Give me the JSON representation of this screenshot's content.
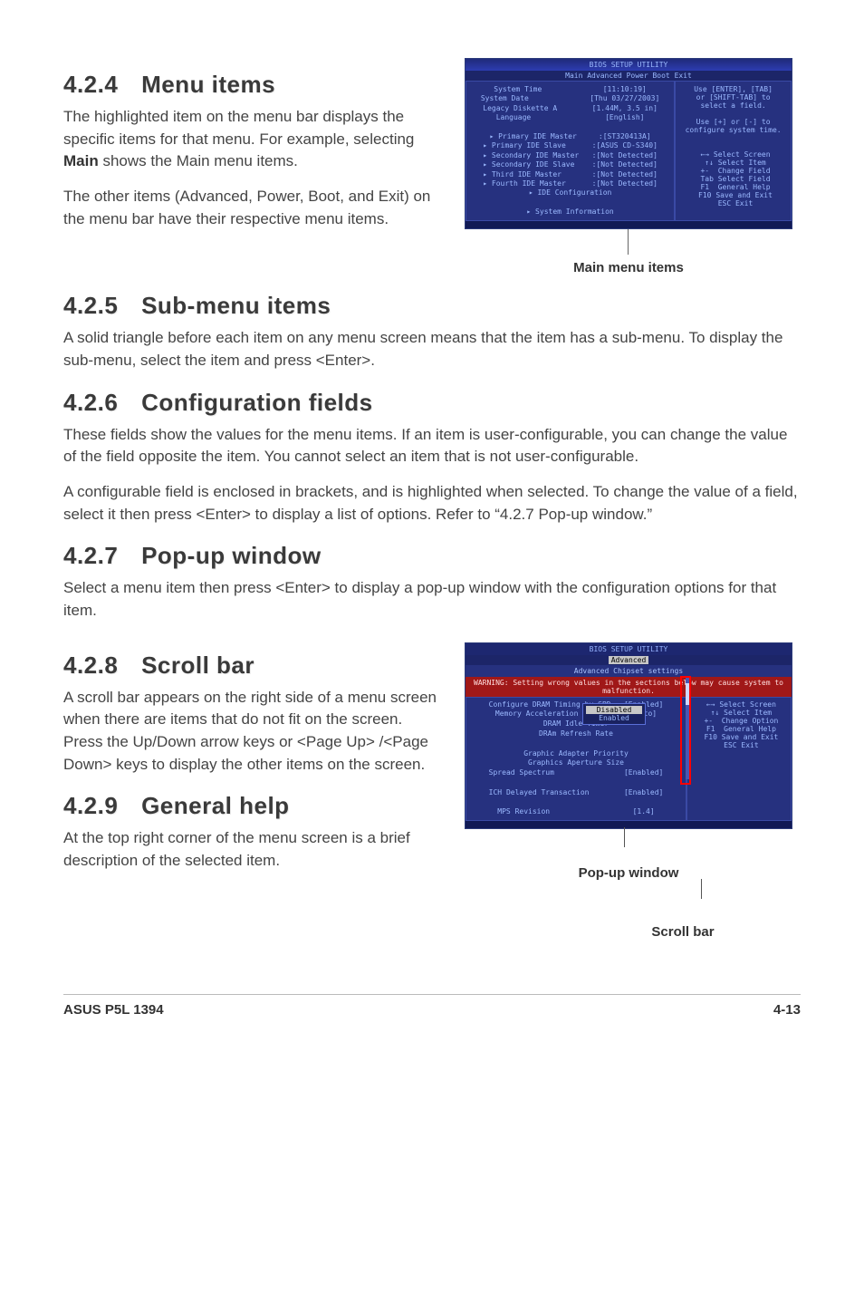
{
  "sections": {
    "s424": {
      "num": "4.2.4",
      "title": "Menu items",
      "p1": "The highlighted item on the menu bar displays the specific items for that menu. For example, selecting ",
      "p1_bold": "Main",
      "p1_after": " shows the Main menu items.",
      "p2": "The other items (Advanced, Power, Boot, and Exit) on the menu bar have their respective menu items."
    },
    "s425": {
      "num": "4.2.5",
      "title": "Sub-menu items",
      "p1": "A solid triangle before each item on any menu screen means that the item has a sub-menu. To display the sub-menu, select the item and press <Enter>."
    },
    "s426": {
      "num": "4.2.6",
      "title": "Configuration fields",
      "p1": "These fields show the values for the menu items. If an item is user-configurable, you can change the value of the field opposite the item. You cannot select an item that is not user-configurable.",
      "p2": "A configurable field is enclosed in brackets, and is highlighted when selected. To change the value of a field, select it then press <Enter> to display a list of options. Refer to “4.2.7 Pop-up window.”"
    },
    "s427": {
      "num": "4.2.7",
      "title": "Pop-up window",
      "p1": "Select a menu item then press <Enter> to display a pop-up window with the configuration options for that item."
    },
    "s428": {
      "num": "4.2.8",
      "title": "Scroll bar",
      "p1": "A scroll bar appears on the right side of a menu screen when there are items that do not fit on the screen. Press the Up/Down arrow keys or <Page Up> /<Page Down> keys to display the other items on the screen."
    },
    "s429": {
      "num": "4.2.9",
      "title": "General help",
      "p1": "At the top right corner of the menu screen is a brief description of the selected item."
    }
  },
  "figure1": {
    "caption": "Main menu items",
    "titlebar": "BIOS SETUP UTILITY",
    "menubar": "Main  Advanced  Power  Boot  Exit",
    "left_lines": [
      "System Time              [11:10:19]",
      "System Date              [Thu 03/27/2003]",
      "Legacy Diskette A        [1.44M, 3.5 in]",
      "Language                 [English]",
      "",
      "▸ Primary IDE Master     :[ST320413A]",
      "▸ Primary IDE Slave      :[ASUS CD-S340]",
      "▸ Secondary IDE Master   :[Not Detected]",
      "▸ Secondary IDE Slave    :[Not Detected]",
      "▸ Third IDE Master       :[Not Detected]",
      "▸ Fourth IDE Master      :[Not Detected]",
      "▸ IDE Configuration",
      "",
      "▸ System Information"
    ],
    "right_lines": [
      "Use [ENTER], [TAB]",
      "or [SHIFT-TAB] to",
      "select a field.",
      "",
      "Use [+] or [-] to",
      "configure system time.",
      "",
      "",
      " ←→ Select Screen",
      " ↑↓ Select Item",
      " +-  Change Field",
      " Tab Select Field",
      " F1  General Help",
      " F10 Save and Exit",
      " ESC Exit"
    ]
  },
  "figure2": {
    "caption_popup": "Pop-up window",
    "caption_scroll": "Scroll bar",
    "titlebar": "BIOS SETUP UTILITY",
    "menubar_sel": "Advanced",
    "heading": "Advanced Chipset settings",
    "warning": "WARNING: Setting wrong values in the sections below may cause system to malfunction.",
    "left_lines": [
      "Configure DRAM Timing by SPD   [Enabled]",
      "Memory Acceleration Mode       [Auto]",
      "DRAM Idle Timer",
      "DRAm Refresh Rate",
      "",
      "Graphic Adapter Priority",
      "Graphics Aperture Size",
      "Spread Spectrum                [Enabled]",
      "",
      "ICH Delayed Transaction        [Enabled]",
      "",
      "MPS Revision                   [1.4]"
    ],
    "popup_opts": [
      "Disabled",
      "Enabled"
    ],
    "right_lines": [
      " ←→ Select Screen",
      " ↑↓ Select Item",
      " +-  Change Option",
      " F1  General Help",
      " F10 Save and Exit",
      " ESC Exit"
    ]
  },
  "footer": {
    "left": "ASUS P5L 1394",
    "right": "4-13"
  }
}
